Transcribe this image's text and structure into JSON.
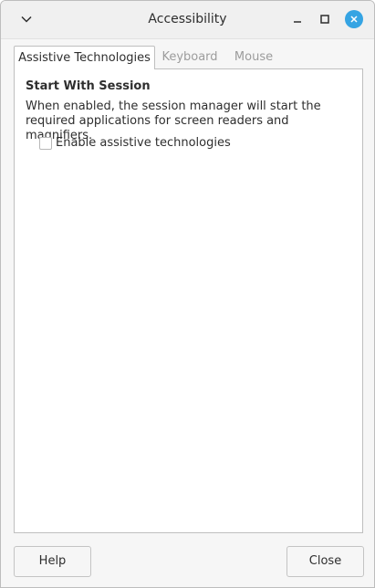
{
  "window": {
    "title": "Accessibility"
  },
  "titlebar": {
    "menu_icon": "chevron-down-icon",
    "minimize_icon": "minimize-icon",
    "maximize_icon": "maximize-icon",
    "close_icon": "close-icon",
    "close_color": "#35a4e3"
  },
  "tabs": [
    {
      "label": "Assistive Technologies",
      "active": true
    },
    {
      "label": "Keyboard",
      "active": false
    },
    {
      "label": "Mouse",
      "active": false
    }
  ],
  "assistive": {
    "section_title": "Start With Session",
    "description": "When enabled, the session manager will start the required applications for screen readers and magnifiers.",
    "checkbox_label": "Enable assistive technologies",
    "checkbox_checked": false
  },
  "buttons": {
    "help": "Help",
    "close": "Close"
  }
}
